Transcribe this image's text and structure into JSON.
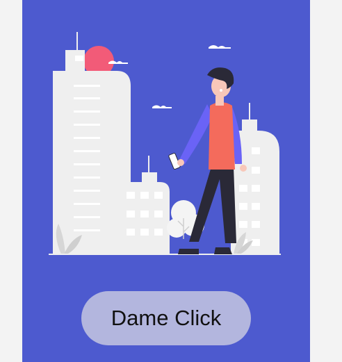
{
  "cta": {
    "label": "Dame Click"
  },
  "illustration": {
    "name": "person-walking-city-illustration"
  },
  "colors": {
    "page_background": "#f3f3f3",
    "card_background": "#4d5acf",
    "button_background": "#b3b6de",
    "button_text": "#111111",
    "sun": "#f25b78",
    "jacket": "#f46b5c",
    "sleeves": "#6a63f6",
    "pants": "#2a2937",
    "buildings": "#efefef"
  }
}
